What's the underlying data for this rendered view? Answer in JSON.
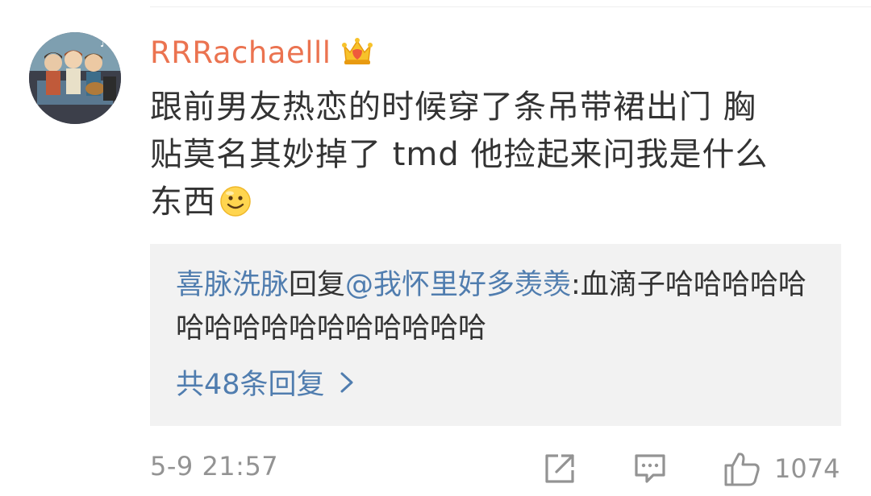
{
  "comment": {
    "username": "RRRachaelll",
    "text_line1": "跟前男友热恋的时候穿了条吊带裙出门 胸",
    "text_line2": "贴莫名其妙掉了 tmd 他捡起来问我是什么",
    "text_line3": "东西",
    "emoji": "smile-emoji",
    "timestamp": "5-9 21:57",
    "like_count": "1074"
  },
  "reply": {
    "author": "喜脉洗脉",
    "reply_word": "回复",
    "mention": "@我怀里好多羡羡",
    "text": ":血滴子哈哈哈哈哈哈哈哈哈哈哈哈哈哈哈哈",
    "more_label": "共48条回复"
  },
  "colors": {
    "username": "#eb7350",
    "link": "#507daf",
    "text": "#333333",
    "meta": "#939393",
    "reply_bg": "#f2f2f2"
  },
  "icons": {
    "badge": "crown-vip-icon",
    "share": "share-icon",
    "comment": "comment-icon",
    "like": "thumbs-up-icon",
    "more": "chevron-right-icon"
  }
}
